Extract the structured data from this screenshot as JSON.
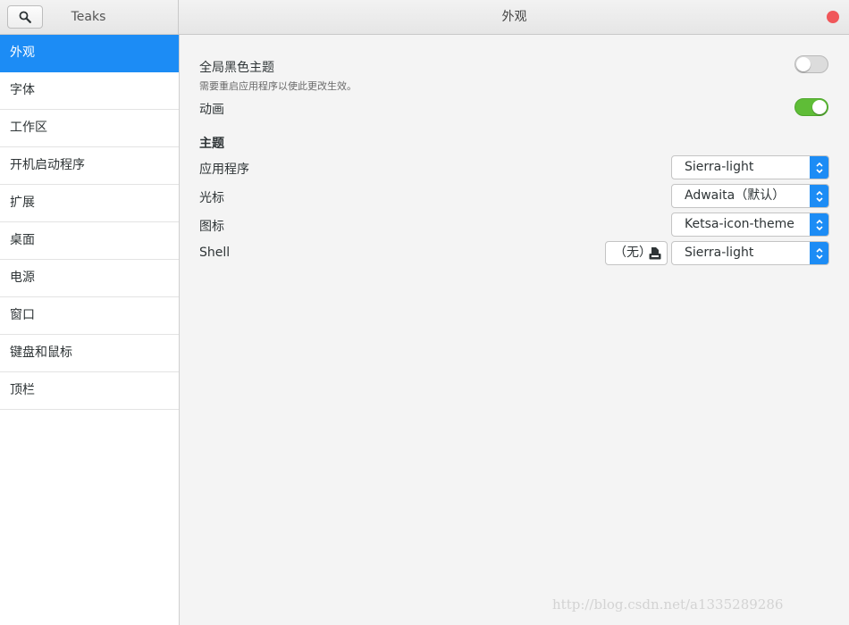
{
  "header": {
    "app_title": "Teaks",
    "page_title": "外观"
  },
  "sidebar": {
    "items": [
      {
        "label": "外观",
        "active": true
      },
      {
        "label": "字体"
      },
      {
        "label": "工作区"
      },
      {
        "label": "开机启动程序"
      },
      {
        "label": "扩展"
      },
      {
        "label": "桌面"
      },
      {
        "label": "电源"
      },
      {
        "label": "窗口"
      },
      {
        "label": "键盘和鼠标"
      },
      {
        "label": "顶栏"
      }
    ]
  },
  "settings": {
    "dark_theme": {
      "label": "全局黑色主题",
      "description": "需要重启应用程序以使此更改生效。",
      "enabled": false
    },
    "animations": {
      "label": "动画",
      "enabled": true
    }
  },
  "theme": {
    "section_title": "主题",
    "applications": {
      "label": "应用程序",
      "value": "Sierra-light"
    },
    "cursor": {
      "label": "光标",
      "value": "Adwaita（默认）"
    },
    "icons": {
      "label": "图标",
      "value": "Ketsa-icon-theme"
    },
    "shell": {
      "label": "Shell",
      "file_button": "（无）",
      "value": "Sierra-light"
    }
  },
  "watermark": "http://blog.csdn.net/a1335289286",
  "colors": {
    "accent": "#1c8cf5",
    "switch_on": "#5fbd37",
    "close": "#f0575a"
  },
  "icons": {
    "search": "search-icon",
    "close": "close-icon",
    "combo_arrow": "chevron-up-down-icon",
    "file": "document-icon"
  }
}
